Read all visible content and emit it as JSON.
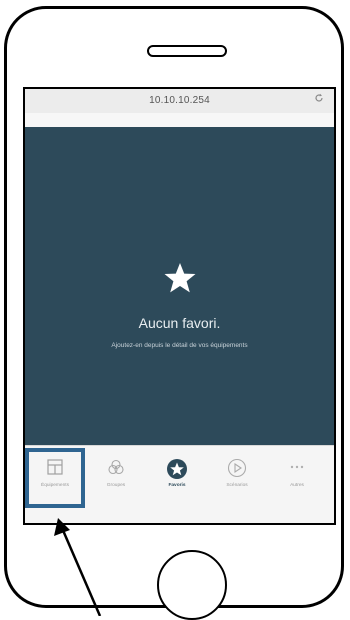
{
  "browser": {
    "url": "10.10.10.254",
    "reload_icon": "reload-icon"
  },
  "empty_state": {
    "icon": "star-icon",
    "title": "Aucun favori.",
    "subtitle": "Ajoutez-en depuis le détail de vos équipements"
  },
  "tabs": [
    {
      "label": "Équipements",
      "icon": "devices-icon",
      "active": false,
      "highlighted": true
    },
    {
      "label": "Groupes",
      "icon": "groups-icon",
      "active": false,
      "highlighted": false
    },
    {
      "label": "Favoris",
      "icon": "star-icon",
      "active": true,
      "highlighted": false
    },
    {
      "label": "Scénarios",
      "icon": "play-icon",
      "active": false,
      "highlighted": false
    },
    {
      "label": "Autres",
      "icon": "more-icon",
      "active": false,
      "highlighted": false
    }
  ],
  "colors": {
    "background": "#2d4a5a",
    "highlight_border": "#2f6591",
    "tabbar": "#f5f5f5"
  }
}
